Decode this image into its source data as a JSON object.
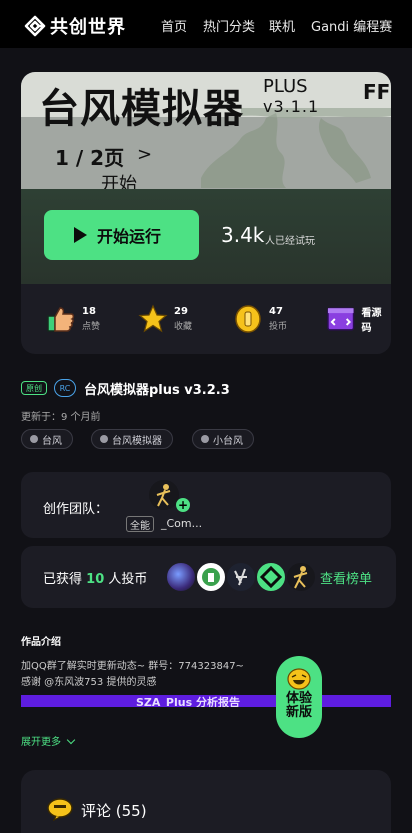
{
  "brand": {
    "name": "共创世界"
  },
  "nav": {
    "items": [
      "首页",
      "热门分类",
      "联机",
      "Gandi 编程赛"
    ]
  },
  "cover": {
    "title": "台风模拟器",
    "plus": "PLUS",
    "version": "v3.1.1",
    "corner": "FF",
    "page": "1 / 2页",
    "page_arrow": ">",
    "start": "开始"
  },
  "run": {
    "label": "开始运行",
    "plays_count": "3.4k",
    "plays_label": "人已经试玩"
  },
  "stats": {
    "likes": {
      "count": "18",
      "label": "点赞"
    },
    "favorites": {
      "count": "29",
      "label": "收藏"
    },
    "coins": {
      "count": "47",
      "label": "投币"
    },
    "source": {
      "label": "看源码"
    }
  },
  "project": {
    "badge_original": "原创",
    "badge_rc": "RC",
    "title": "台风模拟器plus v3.2.3",
    "updated": "更新于：9 个月前",
    "tags": [
      "台风",
      "台风模拟器",
      "小台风"
    ]
  },
  "team": {
    "label": "创作团队：",
    "role": "全能",
    "member": "_Com..."
  },
  "coin_panel": {
    "prefix": "已获得",
    "count": "10",
    "suffix": "人投币",
    "rank_link": "查看榜单"
  },
  "intro": {
    "title": "作品介绍",
    "line1": "加QQ群了解实时更新动态~ 群号：774323847~",
    "line2": "感谢 @东风波753 提供的灵感",
    "banner": "SZA_Plus 分析报告",
    "expand": "展开更多"
  },
  "try_button": {
    "label": "体验新版"
  },
  "comments": {
    "label": "评论 (55)"
  },
  "colors": {
    "accent": "#4de184",
    "background": "#111116",
    "panel": "#1c1c24",
    "banner": "#5e1de0",
    "rc": "#4aa3e8"
  }
}
